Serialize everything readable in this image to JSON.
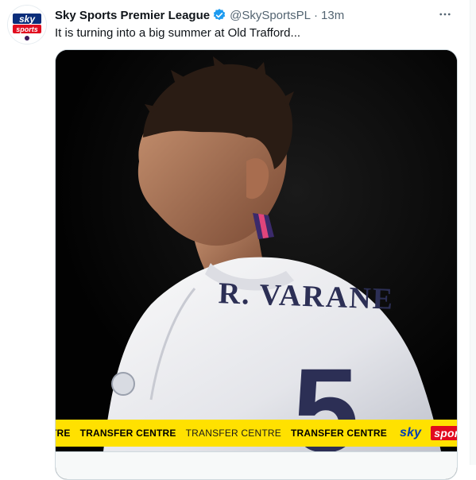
{
  "account": {
    "display_name": "Sky Sports Premier League",
    "handle": "@SkySportsPL",
    "separator": "·",
    "time": "13m",
    "avatar_text_top": "sky",
    "avatar_text_bottom": "sports"
  },
  "tweet": {
    "text": "It is turning into a big summer at Old Trafford..."
  },
  "media": {
    "jersey_name": "R. VARANE",
    "jersey_number": "5",
    "ticker": [
      {
        "text": "TRE",
        "style": "bold"
      },
      {
        "text": "TRANSFER CENTRE",
        "style": "bold"
      },
      {
        "text": "TRANSFER CENTRE",
        "style": "light"
      },
      {
        "text": "TRANSFER CENTRE",
        "style": "bold"
      }
    ],
    "logo_sky": "sky",
    "logo_sports": "sports"
  },
  "link_card": {
    "text": ""
  },
  "colors": {
    "verified": "#1d9bf0",
    "ticker_bg": "#ffe100",
    "sky_blue": "#003cb4",
    "sports_red": "#e10a1e"
  },
  "icons": [
    "verified-badge-icon",
    "more-options-icon"
  ]
}
